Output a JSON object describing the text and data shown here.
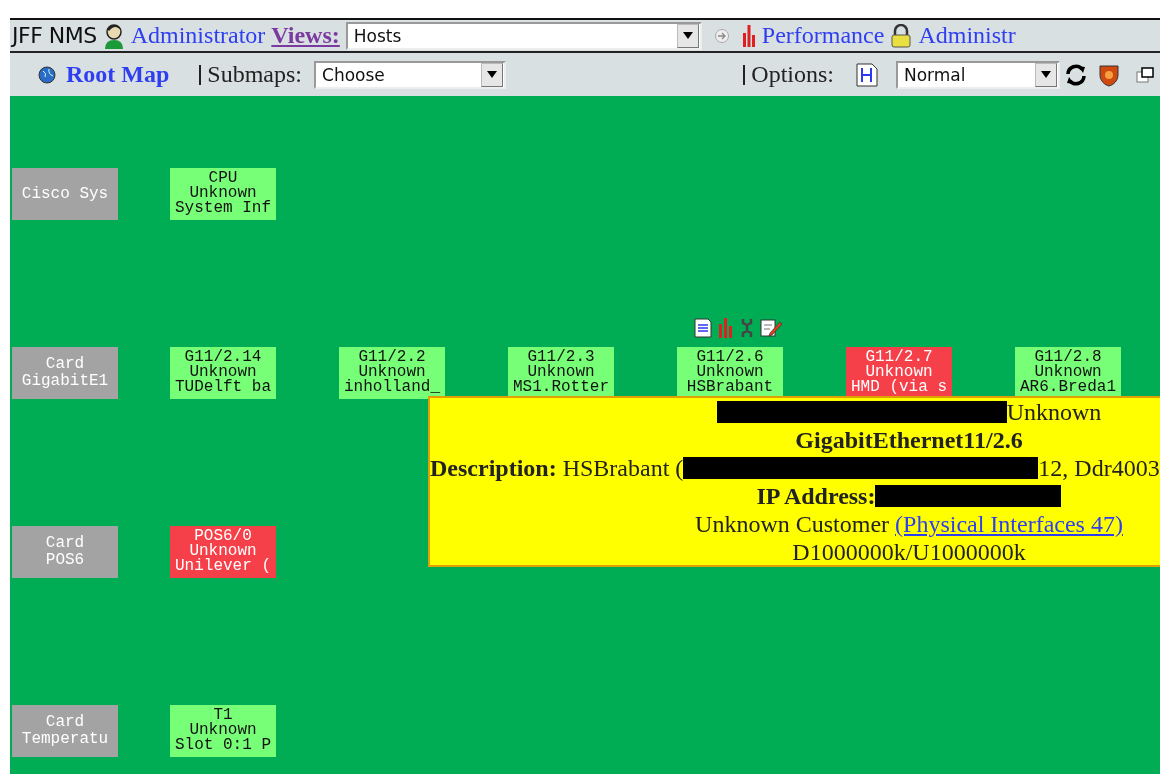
{
  "header": {
    "brand": "JFF NMS",
    "user_link": "Administrator",
    "views_link": "Views:",
    "views_select": {
      "value": "Hosts"
    },
    "nav_links": [
      {
        "label": "Performance",
        "kind": "performance"
      },
      {
        "label": "Administr",
        "kind": "admin"
      }
    ]
  },
  "toolbar": {
    "root_map_link": "Root Map",
    "submaps_label": "Submaps:",
    "submaps_select": {
      "value": "Choose"
    },
    "options_label": "Options:",
    "options_select": {
      "value": "Normal"
    }
  },
  "map": {
    "rows": [
      {
        "label": [
          "Cisco Sys"
        ],
        "nodes": [
          {
            "lines": [
              "CPU",
              "Unknown",
              "System Inf"
            ],
            "color": "#77ff77",
            "selected": false
          }
        ]
      },
      {
        "label": [
          "Card",
          "GigabitE1"
        ],
        "nodes": [
          {
            "lines": [
              "G11/2.14",
              "Unknown",
              "TUDelft ba"
            ],
            "color": "#77ff77",
            "selected": false
          },
          {
            "lines": [
              "G11/2.2",
              "Unknown",
              "inholland_"
            ],
            "color": "#77ff77",
            "selected": false
          },
          {
            "lines": [
              "G11/2.3",
              "Unknown",
              "MS1.Rotter"
            ],
            "color": "#77ff77",
            "selected": false
          },
          {
            "lines": [
              "G11/2.6",
              "Unknown",
              "HSBrabant"
            ],
            "color": "#77ff77",
            "selected": true
          },
          {
            "lines": [
              "G11/2.7",
              "Unknown",
              "HMD (via s"
            ],
            "color": "#f5404a",
            "selected": false
          },
          {
            "lines": [
              "G11/2.8",
              "Unknown",
              "AR6.Breda1"
            ],
            "color": "#77ff77",
            "selected": false
          }
        ]
      },
      {
        "label": [
          "Card",
          "POS6"
        ],
        "nodes": [
          {
            "lines": [
              "POS6/0",
              "Unknown",
              "Unilever ("
            ],
            "color": "#f5404a",
            "selected": false
          }
        ]
      },
      {
        "label": [
          "Card",
          "Temperatu"
        ],
        "nodes": [
          {
            "lines": [
              "T1",
              "Unknown",
              "Slot 0:1 P"
            ],
            "color": "#77ff77",
            "selected": false
          }
        ]
      }
    ]
  },
  "tooltip": {
    "lines": [
      {
        "kind": "redacted_prefix",
        "text": "Unknown"
      },
      {
        "kind": "title",
        "text": "GigabitEthernet11/2.6"
      },
      {
        "kind": "description",
        "label": "Description:",
        "before": "HSBrabant (",
        "after": "12, Ddr4003"
      },
      {
        "kind": "ip",
        "label": "IP Address:"
      },
      {
        "kind": "customer",
        "text": "Unknown Customer",
        "link": "(Physical Interfaces 47)"
      },
      {
        "kind": "plain",
        "text": "D1000000k/U1000000k"
      }
    ]
  }
}
